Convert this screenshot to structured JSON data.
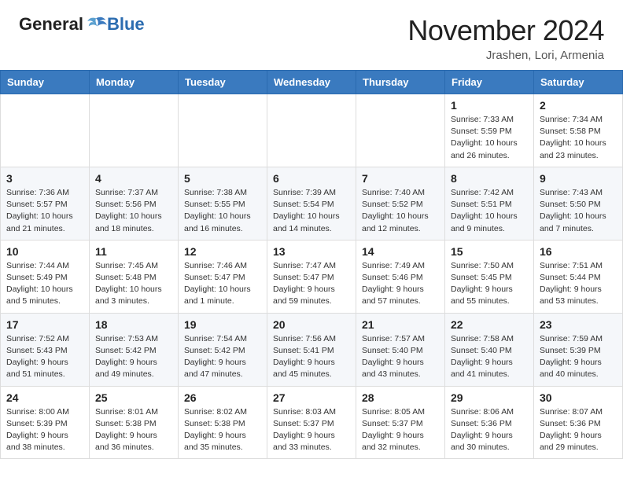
{
  "header": {
    "logo_general": "General",
    "logo_blue": "Blue",
    "month_title": "November 2024",
    "location": "Jrashen, Lori, Armenia"
  },
  "days_of_week": [
    "Sunday",
    "Monday",
    "Tuesday",
    "Wednesday",
    "Thursday",
    "Friday",
    "Saturday"
  ],
  "weeks": [
    [
      {
        "day": "",
        "info": ""
      },
      {
        "day": "",
        "info": ""
      },
      {
        "day": "",
        "info": ""
      },
      {
        "day": "",
        "info": ""
      },
      {
        "day": "",
        "info": ""
      },
      {
        "day": "1",
        "info": "Sunrise: 7:33 AM\nSunset: 5:59 PM\nDaylight: 10 hours and 26 minutes."
      },
      {
        "day": "2",
        "info": "Sunrise: 7:34 AM\nSunset: 5:58 PM\nDaylight: 10 hours and 23 minutes."
      }
    ],
    [
      {
        "day": "3",
        "info": "Sunrise: 7:36 AM\nSunset: 5:57 PM\nDaylight: 10 hours and 21 minutes."
      },
      {
        "day": "4",
        "info": "Sunrise: 7:37 AM\nSunset: 5:56 PM\nDaylight: 10 hours and 18 minutes."
      },
      {
        "day": "5",
        "info": "Sunrise: 7:38 AM\nSunset: 5:55 PM\nDaylight: 10 hours and 16 minutes."
      },
      {
        "day": "6",
        "info": "Sunrise: 7:39 AM\nSunset: 5:54 PM\nDaylight: 10 hours and 14 minutes."
      },
      {
        "day": "7",
        "info": "Sunrise: 7:40 AM\nSunset: 5:52 PM\nDaylight: 10 hours and 12 minutes."
      },
      {
        "day": "8",
        "info": "Sunrise: 7:42 AM\nSunset: 5:51 PM\nDaylight: 10 hours and 9 minutes."
      },
      {
        "day": "9",
        "info": "Sunrise: 7:43 AM\nSunset: 5:50 PM\nDaylight: 10 hours and 7 minutes."
      }
    ],
    [
      {
        "day": "10",
        "info": "Sunrise: 7:44 AM\nSunset: 5:49 PM\nDaylight: 10 hours and 5 minutes."
      },
      {
        "day": "11",
        "info": "Sunrise: 7:45 AM\nSunset: 5:48 PM\nDaylight: 10 hours and 3 minutes."
      },
      {
        "day": "12",
        "info": "Sunrise: 7:46 AM\nSunset: 5:47 PM\nDaylight: 10 hours and 1 minute."
      },
      {
        "day": "13",
        "info": "Sunrise: 7:47 AM\nSunset: 5:47 PM\nDaylight: 9 hours and 59 minutes."
      },
      {
        "day": "14",
        "info": "Sunrise: 7:49 AM\nSunset: 5:46 PM\nDaylight: 9 hours and 57 minutes."
      },
      {
        "day": "15",
        "info": "Sunrise: 7:50 AM\nSunset: 5:45 PM\nDaylight: 9 hours and 55 minutes."
      },
      {
        "day": "16",
        "info": "Sunrise: 7:51 AM\nSunset: 5:44 PM\nDaylight: 9 hours and 53 minutes."
      }
    ],
    [
      {
        "day": "17",
        "info": "Sunrise: 7:52 AM\nSunset: 5:43 PM\nDaylight: 9 hours and 51 minutes."
      },
      {
        "day": "18",
        "info": "Sunrise: 7:53 AM\nSunset: 5:42 PM\nDaylight: 9 hours and 49 minutes."
      },
      {
        "day": "19",
        "info": "Sunrise: 7:54 AM\nSunset: 5:42 PM\nDaylight: 9 hours and 47 minutes."
      },
      {
        "day": "20",
        "info": "Sunrise: 7:56 AM\nSunset: 5:41 PM\nDaylight: 9 hours and 45 minutes."
      },
      {
        "day": "21",
        "info": "Sunrise: 7:57 AM\nSunset: 5:40 PM\nDaylight: 9 hours and 43 minutes."
      },
      {
        "day": "22",
        "info": "Sunrise: 7:58 AM\nSunset: 5:40 PM\nDaylight: 9 hours and 41 minutes."
      },
      {
        "day": "23",
        "info": "Sunrise: 7:59 AM\nSunset: 5:39 PM\nDaylight: 9 hours and 40 minutes."
      }
    ],
    [
      {
        "day": "24",
        "info": "Sunrise: 8:00 AM\nSunset: 5:39 PM\nDaylight: 9 hours and 38 minutes."
      },
      {
        "day": "25",
        "info": "Sunrise: 8:01 AM\nSunset: 5:38 PM\nDaylight: 9 hours and 36 minutes."
      },
      {
        "day": "26",
        "info": "Sunrise: 8:02 AM\nSunset: 5:38 PM\nDaylight: 9 hours and 35 minutes."
      },
      {
        "day": "27",
        "info": "Sunrise: 8:03 AM\nSunset: 5:37 PM\nDaylight: 9 hours and 33 minutes."
      },
      {
        "day": "28",
        "info": "Sunrise: 8:05 AM\nSunset: 5:37 PM\nDaylight: 9 hours and 32 minutes."
      },
      {
        "day": "29",
        "info": "Sunrise: 8:06 AM\nSunset: 5:36 PM\nDaylight: 9 hours and 30 minutes."
      },
      {
        "day": "30",
        "info": "Sunrise: 8:07 AM\nSunset: 5:36 PM\nDaylight: 9 hours and 29 minutes."
      }
    ]
  ]
}
